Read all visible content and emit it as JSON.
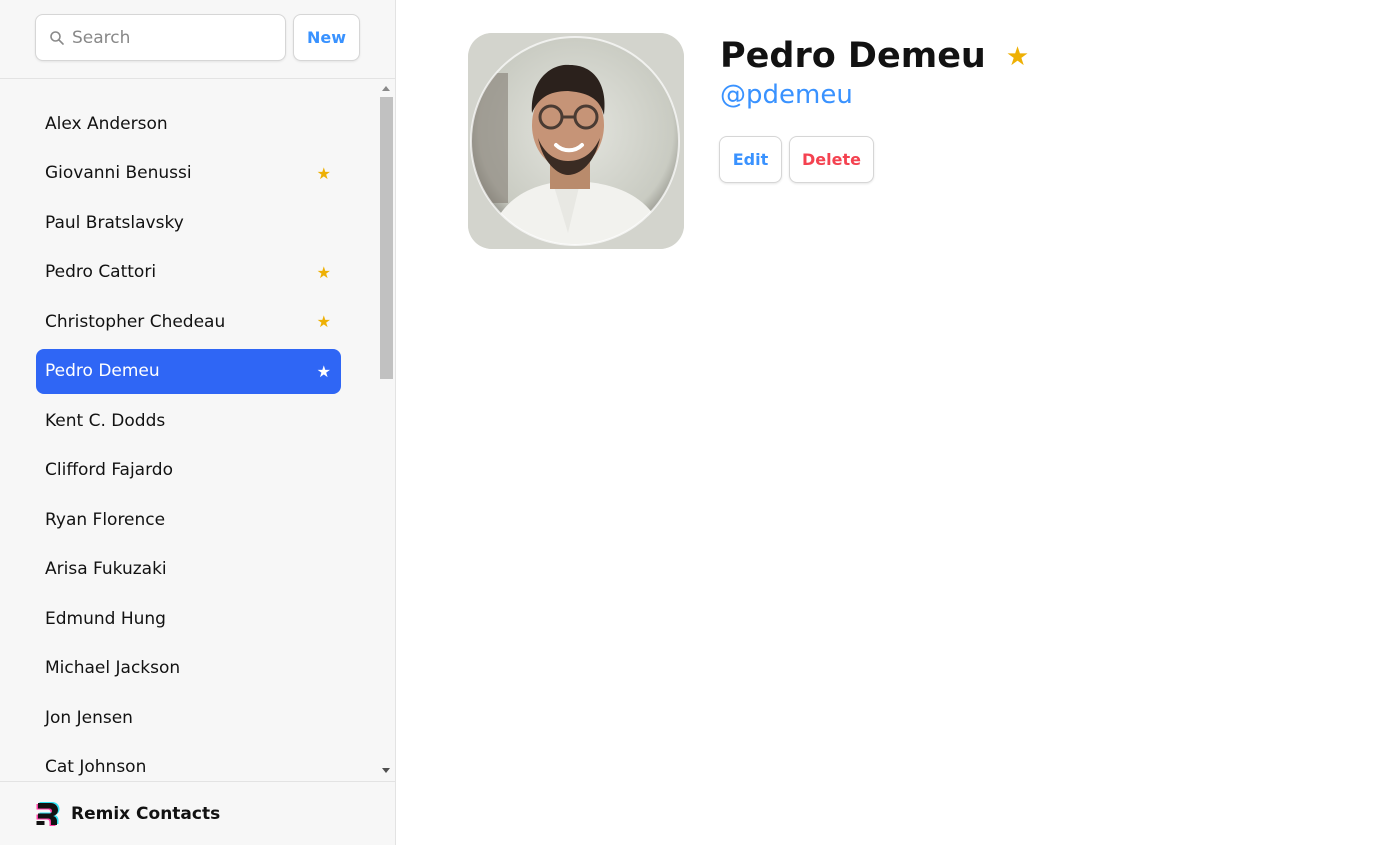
{
  "search": {
    "placeholder": "Search"
  },
  "toolbar": {
    "new_label": "New"
  },
  "contacts": [
    {
      "name": "Alex Anderson",
      "favorite": false
    },
    {
      "name": "Giovanni Benussi",
      "favorite": true
    },
    {
      "name": "Paul Bratslavsky",
      "favorite": false
    },
    {
      "name": "Pedro Cattori",
      "favorite": true
    },
    {
      "name": "Christopher Chedeau",
      "favorite": true
    },
    {
      "name": "Pedro Demeu",
      "favorite": true,
      "selected": true
    },
    {
      "name": "Kent C. Dodds",
      "favorite": false
    },
    {
      "name": "Clifford Fajardo",
      "favorite": false
    },
    {
      "name": "Ryan Florence",
      "favorite": false
    },
    {
      "name": "Arisa Fukuzaki",
      "favorite": false
    },
    {
      "name": "Edmund Hung",
      "favorite": false
    },
    {
      "name": "Michael Jackson",
      "favorite": false
    },
    {
      "name": "Jon Jensen",
      "favorite": false
    },
    {
      "name": "Cat Johnson",
      "favorite": false
    }
  ],
  "star_glyph": "★",
  "footer": {
    "brand": "Remix Contacts",
    "logo_icon": "remix-logo-icon"
  },
  "detail": {
    "name": "Pedro Demeu",
    "favorite": true,
    "handle": "@pdemeu",
    "edit_label": "Edit",
    "delete_label": "Delete"
  },
  "colors": {
    "accent": "#3992ff",
    "selected": "#2f66f5",
    "star": "#eeb004",
    "danger": "#f44250"
  }
}
